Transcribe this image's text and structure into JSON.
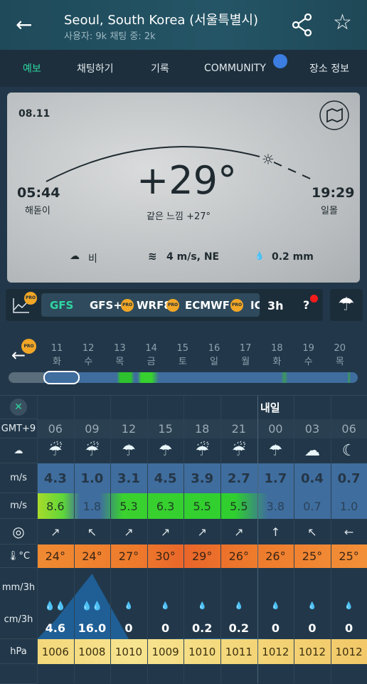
{
  "header": {
    "title": "Seoul, South Korea (서울특별시)",
    "subtitle": "사용자: 9k 채팅 중: 2k",
    "back_icon": "arrow-left-icon",
    "share_icon": "share-icon",
    "favorite_icon": "star-icon"
  },
  "tabs": [
    {
      "label": "예보",
      "active": true
    },
    {
      "label": "채팅하기"
    },
    {
      "label": "기록"
    },
    {
      "label": "COMMUNITY",
      "badge": "globe-badge"
    },
    {
      "label": "장소 정보"
    }
  ],
  "colors": {
    "accent": "#2fd6a0",
    "pro": "#f1a626",
    "header": "#245566",
    "temp": "#ee7a2c",
    "pressure": "#f3d77a",
    "wind": "#3f6d9e",
    "gust": "#36d12f"
  },
  "current": {
    "date": "08.11",
    "sunrise": "05:44",
    "sunrise_label": "해돋이",
    "sunset": "19:29",
    "sunset_label": "일몰",
    "temperature": "+29°",
    "feels_like": "같은 느낌 +27°",
    "condition": "비",
    "wind": "4 m/s, NE",
    "precip": "0.2 mm"
  },
  "models": {
    "items": [
      "GFS",
      "GFS+",
      "WRF8",
      "ECMWF",
      "IC"
    ],
    "active": "GFS",
    "pro_label": "PRO",
    "interval": "3h",
    "help": "?"
  },
  "days": [
    {
      "d": "11",
      "w": "화"
    },
    {
      "d": "12",
      "w": "수"
    },
    {
      "d": "13",
      "w": "목"
    },
    {
      "d": "14",
      "w": "금"
    },
    {
      "d": "15",
      "w": "토"
    },
    {
      "d": "16",
      "w": "일"
    },
    {
      "d": "17",
      "w": "월"
    },
    {
      "d": "18",
      "w": "화"
    },
    {
      "d": "19",
      "w": "수"
    },
    {
      "d": "20",
      "w": "목"
    }
  ],
  "table": {
    "tomorrow_label": "내일",
    "labels": {
      "tz": "GMT+9",
      "wind": "m/s",
      "gust": "m/s",
      "temp": "°C",
      "precip_mm": "mm/3h",
      "precip_cm": "cm/3h",
      "pressure": "hPa"
    },
    "hours": [
      "06",
      "09",
      "12",
      "15",
      "18",
      "21",
      "00",
      "03",
      "06"
    ],
    "icons": [
      "heavy-rain",
      "heavy-rain",
      "light-rain",
      "light-rain",
      "heavy-rain",
      "heavy-rain",
      "light-rain",
      "cloud-moon",
      "moon"
    ],
    "wind": [
      "4.3",
      "1.0",
      "3.1",
      "4.5",
      "3.9",
      "2.7",
      "1.7",
      "0.4",
      "0.7"
    ],
    "gust": [
      "8.6",
      "1.8",
      "5.3",
      "6.3",
      "5.5",
      "5.5",
      "3.8",
      "0.7",
      "1.0"
    ],
    "direction": [
      "↗",
      "↖",
      "↗",
      "↗",
      "↗",
      "↗",
      "↑",
      "↖",
      "←"
    ],
    "temp": [
      "24°",
      "24°",
      "27°",
      "30°",
      "29°",
      "26°",
      "26°",
      "25°",
      "25°"
    ],
    "precip": [
      "4.6",
      "16.0",
      "0",
      "0",
      "0.2",
      "0.2",
      "0",
      "0",
      "0"
    ],
    "pressure": [
      "1006",
      "1008",
      "1010",
      "1009",
      "1010",
      "1011",
      "1012",
      "1012",
      "1012"
    ]
  }
}
